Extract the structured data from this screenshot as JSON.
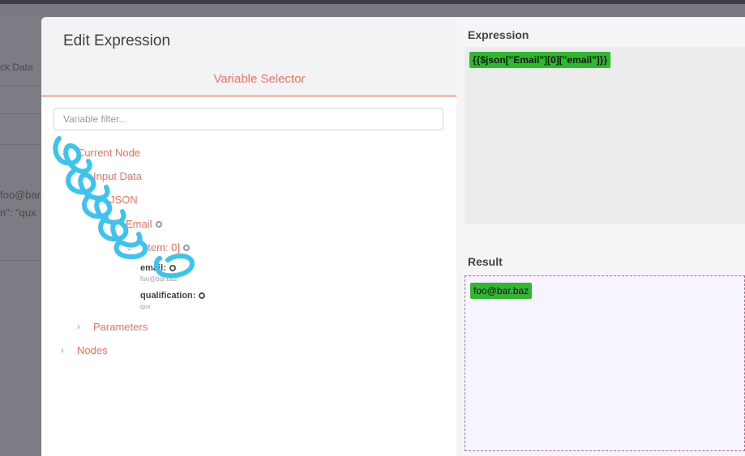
{
  "background": {
    "tab_fragment": "ck Data",
    "email_fragment": "foo@bar.ba",
    "qual_fragment": "n\": \"qux"
  },
  "modal": {
    "title": "Edit Expression",
    "selector_title": "Variable Selector",
    "filter_placeholder": "Variable filter...",
    "tree": {
      "current_node": "Current Node",
      "input_data": "Input Data",
      "json": "JSON",
      "email": "Email",
      "item": "[Item: 0]",
      "leaf_email_key": "email:",
      "leaf_email_value": "foo@bar.baz",
      "leaf_qual_key": "qualification:",
      "leaf_qual_value": "qux",
      "parameters": "Parameters",
      "nodes": "Nodes"
    },
    "expression_label": "Expression",
    "expression_value": "{{$json[\"Email\"][0][\"email\"]}}",
    "result_label": "Result",
    "result_value": "foo@bar.baz"
  },
  "colors": {
    "accent": "#ff6d5a",
    "highlight": "#2eb82e",
    "scribble": "#3cc4ee"
  },
  "icons": {
    "chevron_down": "chevron-down-icon",
    "chevron_right": "chevron-right-icon",
    "circle": "circle-dot-icon"
  }
}
